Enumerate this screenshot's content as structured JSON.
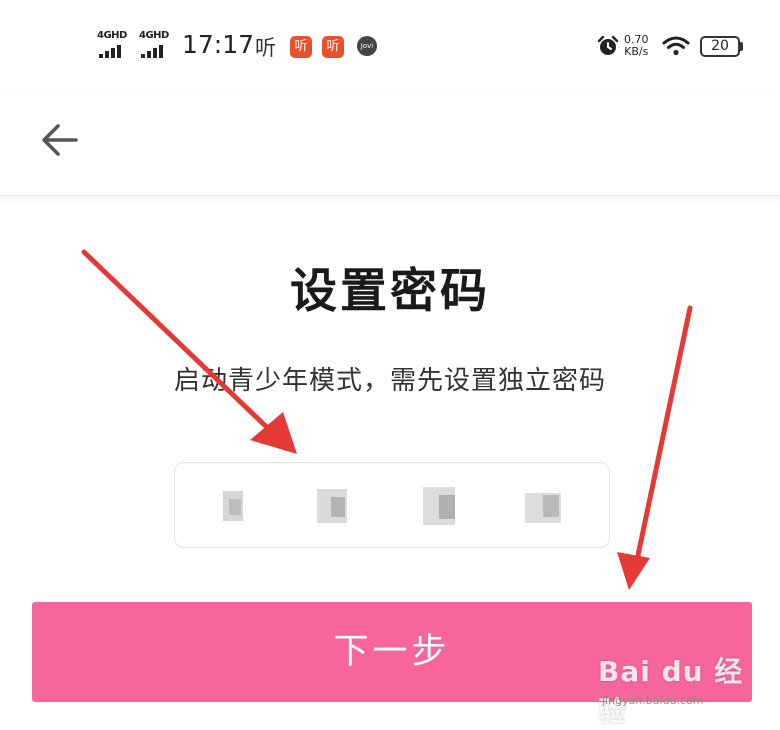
{
  "status_bar": {
    "network_1": "4GHD",
    "network_2": "4GHD",
    "time": "17:17",
    "listen_label": "听",
    "app_icon_1": "听",
    "app_icon_2": "听",
    "jovi_label": "Jovi",
    "speed_value": "0.70",
    "speed_unit": "KB/s",
    "battery": "20"
  },
  "nav": {
    "back_icon": "arrow-left-icon"
  },
  "page": {
    "title": "设置密码",
    "subtitle": "启动青少年模式，需先设置独立密码",
    "pin_length": 4,
    "next_label": "下一步"
  },
  "colors": {
    "accent": "#f7669b",
    "arrow": "#e53935",
    "app_icon": "#e8512b"
  },
  "watermark": {
    "brand": "Bai du 经验",
    "url": "jingyan.baidu.com"
  }
}
